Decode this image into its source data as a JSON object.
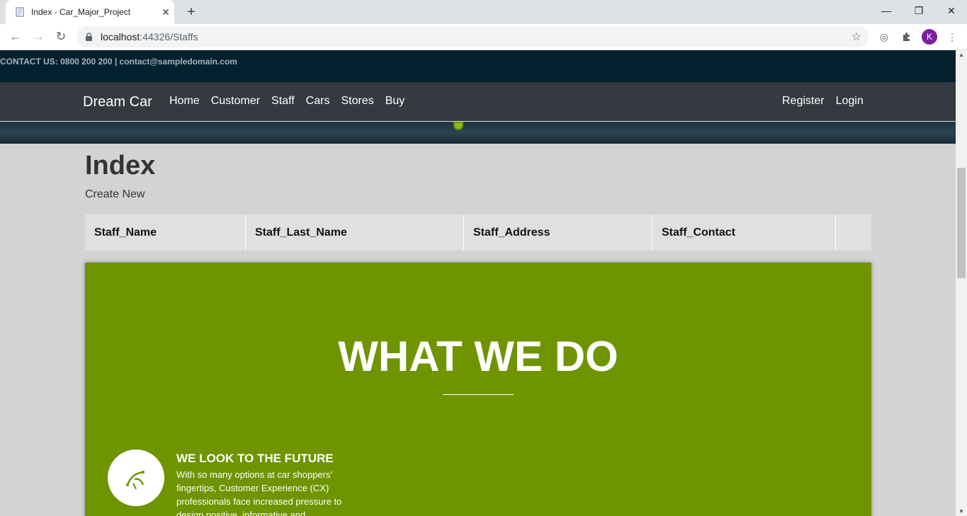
{
  "browser": {
    "tab_title": "Index - Car_Major_Project",
    "url_host": "localhost",
    "url_port_path": ":44326/Staffs",
    "profile_initial": "K"
  },
  "contact_bar": {
    "text": "CONTACT US: 0800 200 200 | contact@sampledomain.com"
  },
  "navbar": {
    "brand": "Dream Car",
    "links": [
      "Home",
      "Customer",
      "Staff",
      "Cars",
      "Stores",
      "Buy"
    ],
    "right_links": [
      "Register",
      "Login"
    ]
  },
  "page": {
    "title": "Index",
    "create_link": "Create New"
  },
  "table": {
    "headers": [
      "Staff_Name",
      "Staff_Last_Name",
      "Staff_Address",
      "Staff_Contact",
      ""
    ]
  },
  "section": {
    "heading": "WHAT WE DO",
    "feature_title": "WE LOOK TO THE FUTURE",
    "feature_text": "With so many options at car shoppers' fingertips, Customer Experience (CX) professionals face increased pressure to design positive, informative and"
  },
  "colors": {
    "contact_bar_bg": "#03202f",
    "navbar_bg": "#343a40",
    "section_bg": "#6e9400",
    "page_bg": "#d3d3d3"
  }
}
